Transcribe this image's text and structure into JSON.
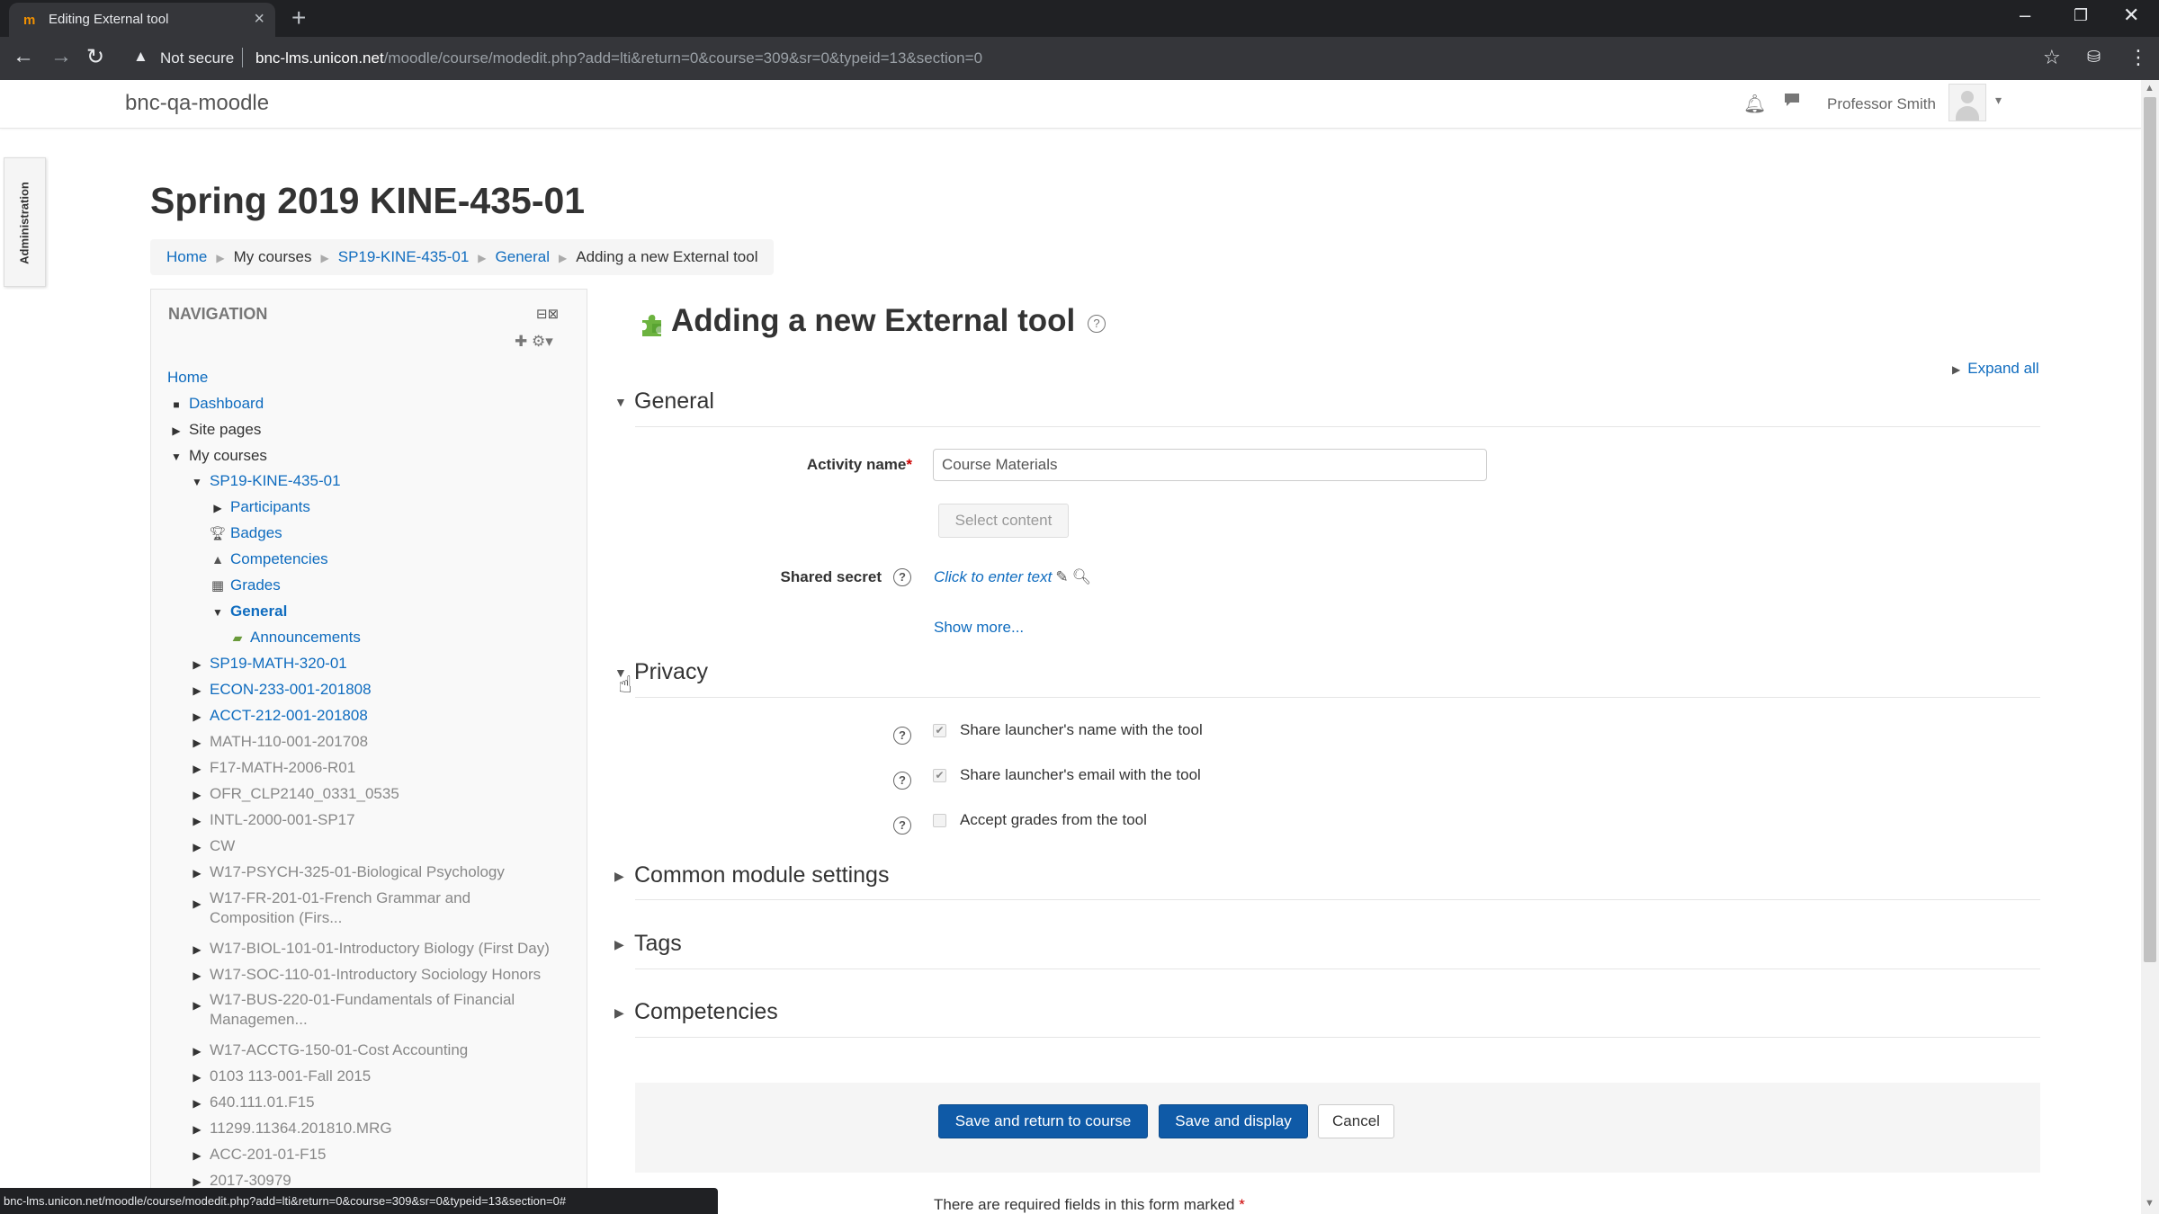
{
  "browser": {
    "tab_title": "Editing External tool",
    "tab_favicon": "m",
    "url_warning": "Not secure",
    "url_host": "bnc-lms.unicon.net",
    "url_path": "/moodle/course/modedit.php?add=lti&return=0&course=309&sr=0&typeid=13&section=0",
    "status_url": "bnc-lms.unicon.net/moodle/course/modedit.php?add=lti&return=0&course=309&sr=0&typeid=13&section=0#"
  },
  "header": {
    "site_name": "bnc-qa-moodle",
    "user_name": "Professor Smith"
  },
  "admin_tab": {
    "label": "Administration"
  },
  "course": {
    "title": "Spring 2019 KINE-435-01"
  },
  "breadcrumb": {
    "items": [
      "Home",
      "My courses",
      "SP19-KINE-435-01",
      "General",
      "Adding a new External tool"
    ]
  },
  "navigation": {
    "heading": "NAVIGATION",
    "home": "Home",
    "dashboard": "Dashboard",
    "site_pages": "Site pages",
    "my_courses": "My courses",
    "current_course": "SP19-KINE-435-01",
    "course_children": [
      "Participants",
      "Badges",
      "Competencies",
      "Grades",
      "General"
    ],
    "general_children": [
      "Announcements"
    ],
    "other_courses": [
      "SP19-MATH-320-01",
      "ECON-233-001-201808",
      "ACCT-212-001-201808",
      "MATH-110-001-201708",
      "F17-MATH-2006-R01",
      "OFR_CLP2140_0331_0535",
      "INTL-2000-001-SP17",
      "CW",
      "W17-PSYCH-325-01-Biological Psychology",
      "W17-FR-201-01-French Grammar and Composition (Firs...",
      "W17-BIOL-101-01-Introductory Biology (First Day)",
      "W17-SOC-110-01-Introductory Sociology Honors",
      "W17-BUS-220-01-Fundamentals of Financial Managemen...",
      "W17-ACCTG-150-01-Cost Accounting",
      "0103 113-001-Fall 2015",
      "640.111.01.F15",
      "11299.11364.201810.MRG",
      "ACC-201-01-F15",
      "2017-30979"
    ]
  },
  "form": {
    "page_heading": "Adding a new External tool",
    "expand_all": "Expand all",
    "sections": {
      "general": "General",
      "privacy": "Privacy",
      "common": "Common module settings",
      "tags": "Tags",
      "competencies": "Competencies"
    },
    "activity_name_label": "Activity name",
    "activity_name_value": "Course Materials",
    "select_content": "Select content",
    "shared_secret_label": "Shared secret",
    "shared_secret_link": "Click to enter text",
    "show_more": "Show more...",
    "privacy_options": [
      {
        "label": "Share launcher's name with the tool",
        "checked": true
      },
      {
        "label": "Share launcher's email with the tool",
        "checked": true
      },
      {
        "label": "Accept grades from the tool",
        "checked": false
      }
    ],
    "buttons": {
      "save_return": "Save and return to course",
      "save_display": "Save and display",
      "cancel": "Cancel"
    },
    "required_note": "There are required fields in this form marked",
    "required_marker": "*"
  },
  "colors": {
    "link": "#0f6cbf",
    "primary_button": "#0f5aa7",
    "required": "#cc0000",
    "chrome_dark": "#202124"
  }
}
